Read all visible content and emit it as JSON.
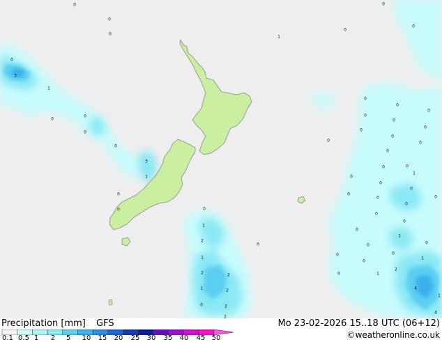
{
  "map": {
    "values": [
      {
        "label": "0"
      },
      {
        "label": "0"
      },
      {
        "label": "0"
      },
      {
        "label": "0"
      },
      {
        "label": "0"
      },
      {
        "label": "0"
      },
      {
        "label": "1"
      },
      {
        "label": "0"
      },
      {
        "label": "3"
      },
      {
        "label": "1"
      },
      {
        "label": "0"
      },
      {
        "label": "0"
      },
      {
        "label": "0"
      },
      {
        "label": "0"
      },
      {
        "label": "3"
      },
      {
        "label": "1"
      },
      {
        "label": "0"
      },
      {
        "label": "0"
      },
      {
        "label": "0"
      },
      {
        "label": "1"
      },
      {
        "label": "2"
      },
      {
        "label": "1"
      },
      {
        "label": "2"
      },
      {
        "label": "2"
      },
      {
        "label": "1"
      },
      {
        "label": "2"
      },
      {
        "label": "0"
      },
      {
        "label": "2"
      },
      {
        "label": "2"
      },
      {
        "label": "0"
      },
      {
        "label": "0"
      },
      {
        "label": "0"
      },
      {
        "label": "0"
      },
      {
        "label": "0"
      },
      {
        "label": "0"
      },
      {
        "label": "0"
      },
      {
        "label": "0"
      },
      {
        "label": "0"
      },
      {
        "label": "0"
      },
      {
        "label": "0"
      },
      {
        "label": "0"
      },
      {
        "label": "0"
      },
      {
        "label": "0"
      },
      {
        "label": "0"
      },
      {
        "label": "0"
      },
      {
        "label": "1"
      },
      {
        "label": "0"
      },
      {
        "label": "0"
      },
      {
        "label": "0"
      },
      {
        "label": "0"
      },
      {
        "label": "0"
      },
      {
        "label": "0"
      },
      {
        "label": "0"
      },
      {
        "label": "0"
      },
      {
        "label": "1"
      },
      {
        "label": "0"
      },
      {
        "label": "0"
      },
      {
        "label": "0"
      },
      {
        "label": "0"
      },
      {
        "label": "0"
      },
      {
        "label": "1"
      },
      {
        "label": "0"
      },
      {
        "label": "1"
      },
      {
        "label": "2"
      },
      {
        "label": "4"
      },
      {
        "label": "1"
      },
      {
        "label": "4"
      }
    ]
  },
  "footer": {
    "title": "Precipitation [mm]",
    "model": "GFS",
    "datetime": "Mo 23-02-2026 15..18 UTC (06+12)",
    "credit": "©weatheronline.co.uk"
  },
  "legend": {
    "ticks": [
      "0.1",
      "0.5",
      "1",
      "2",
      "5",
      "10",
      "15",
      "20",
      "25",
      "30",
      "35",
      "40",
      "45",
      "50"
    ],
    "colors": [
      "#f2f2f2",
      "#c8fcfc",
      "#a8f4f8",
      "#88e8f4",
      "#5ccff0",
      "#3ab0ec",
      "#2a8ce4",
      "#1c64d8",
      "#1238b8",
      "#0a1a98",
      "#6010c0",
      "#9c10d0",
      "#d010d0",
      "#ff10c8",
      "#ff50e8"
    ]
  }
}
